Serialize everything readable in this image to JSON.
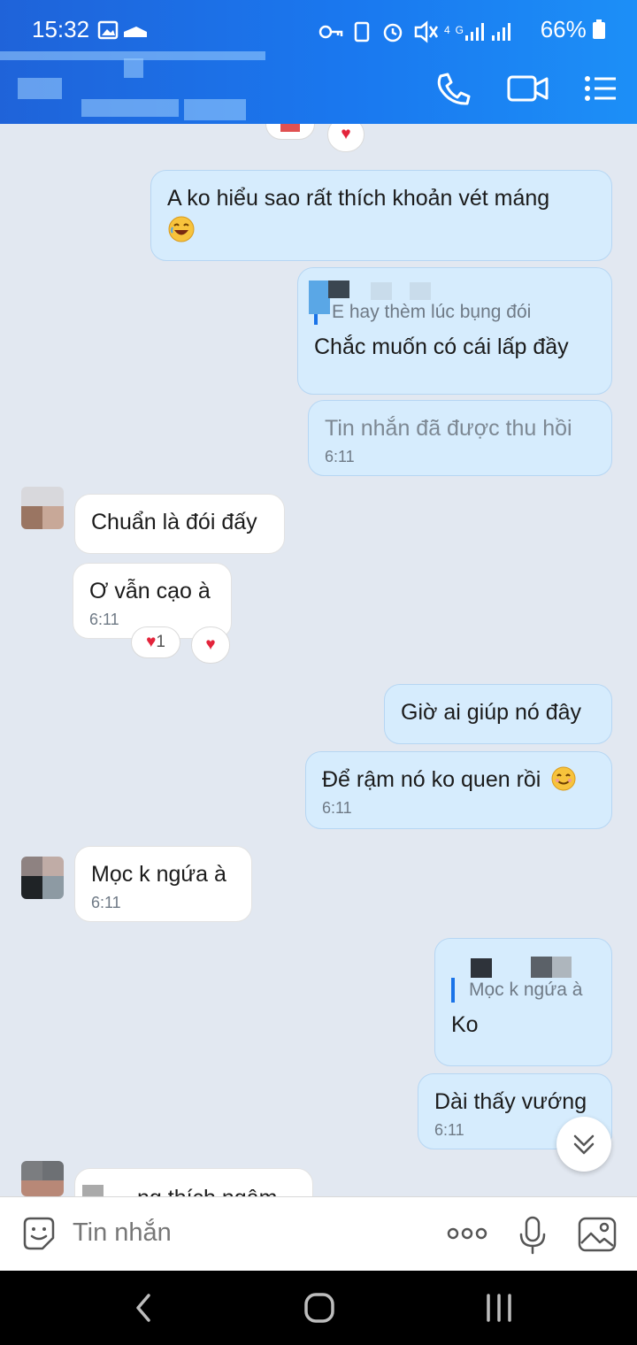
{
  "status_bar": {
    "time": "15:32",
    "battery": "66%",
    "network": "4G"
  },
  "header": {
    "call_icon": "phone-icon",
    "video_icon": "video-call-icon",
    "menu_icon": "menu-icon"
  },
  "messages": {
    "m1_text": "A ko hiểu sao rất thích khoản vét máng",
    "m2_quote": "E hay thèm lúc bụng đói",
    "m2_text": "Chắc muốn có cái lấp đầy",
    "m3_text": "Tin nhắn đã được thu hồi",
    "m3_time": "6:11",
    "m4_text": "Chuẩn là đói đấy",
    "m5_text": "Ơ vẫn cạo à",
    "m5_time": "6:11",
    "m5_react_count": "1",
    "m6_text": "Giờ ai giúp nó đây",
    "m7_text": "Để rậm nó ko quen rồi",
    "m7_time": "6:11",
    "m8_text": "Mọc k ngứa à",
    "m8_time": "6:11",
    "m9_quote": "Mọc k ngứa à",
    "m9_text": "Ko",
    "m10_text": "Dài thấy vướng",
    "m10_time": "6:11",
    "m11_partial": "ng thích ngậm"
  },
  "input": {
    "placeholder": "Tin nhắn",
    "more_label": "ooo"
  },
  "colors": {
    "header_start": "#1f63d9",
    "header_end": "#1c8ff7",
    "my_bubble": "#d6ecfd",
    "their_bubble": "#ffffff",
    "background": "#e2e8f1",
    "heart": "#e3243b"
  }
}
